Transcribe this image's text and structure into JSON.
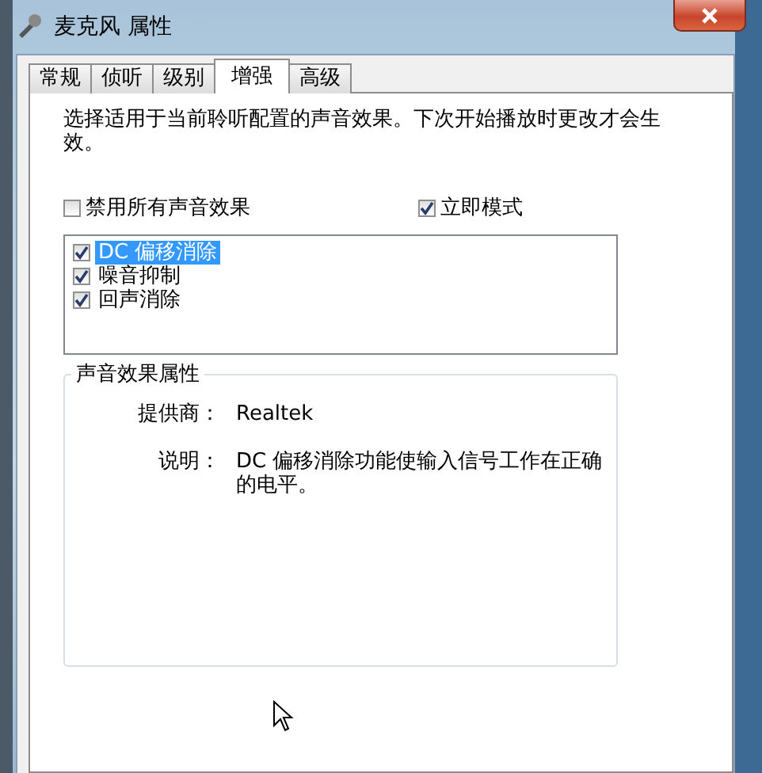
{
  "window": {
    "title": "麦克风 属性"
  },
  "tabs": [
    {
      "label": "常规",
      "selected": false
    },
    {
      "label": "侦听",
      "selected": false
    },
    {
      "label": "级别",
      "selected": false
    },
    {
      "label": "增强",
      "selected": true
    },
    {
      "label": "高级",
      "selected": false
    }
  ],
  "description": "选择适用于当前聆听配置的声音效果。下次开始播放时更改才会生效。",
  "options": [
    {
      "label": "禁用所有声音效果",
      "checked": false
    },
    {
      "label": "立即模式",
      "checked": true
    }
  ],
  "effects": [
    {
      "label": "DC 偏移消除",
      "checked": true,
      "selected": true
    },
    {
      "label": "噪音抑制",
      "checked": true,
      "selected": false
    },
    {
      "label": "回声消除",
      "checked": true,
      "selected": false
    }
  ],
  "properties": {
    "title": "声音效果属性",
    "fields": [
      {
        "label": "提供商：",
        "value": "Realtek"
      },
      {
        "label": "说明：",
        "value": "DC 偏移消除功能使输入信号工作在正确的电平。"
      }
    ]
  }
}
